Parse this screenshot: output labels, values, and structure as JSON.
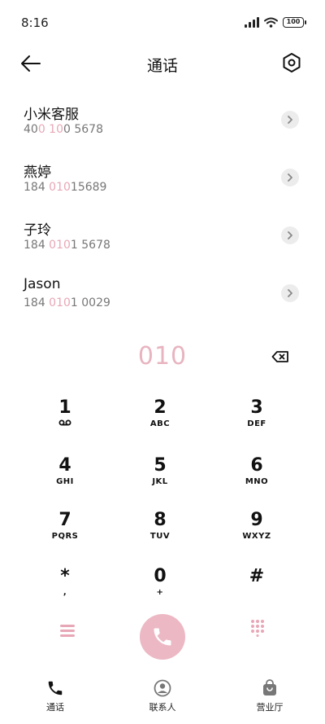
{
  "status_bar": {
    "time": "8:16",
    "battery": "100"
  },
  "header": {
    "title": "通话",
    "back_icon": "arrow-left-icon",
    "settings_icon": "hexagon-settings-icon"
  },
  "contacts": [
    {
      "name": "小米客服",
      "number_pre": "40",
      "number_hl": "0 10",
      "number_post": "0 5678"
    },
    {
      "name": "燕婷",
      "number_pre": "184 ",
      "number_hl": "010",
      "number_post": "15689"
    },
    {
      "name": "子玲",
      "number_pre": "184 ",
      "number_hl": "010",
      "number_post": "1 5678"
    },
    {
      "name": "Jason",
      "number_pre": "184 ",
      "number_hl": "010",
      "number_post": "1 0029"
    }
  ],
  "dialer": {
    "input": "010"
  },
  "keypad": [
    {
      "digit": "1",
      "letters": "",
      "sub": "voicemail-icon"
    },
    {
      "digit": "2",
      "letters": "ABC"
    },
    {
      "digit": "3",
      "letters": "DEF"
    },
    {
      "digit": "4",
      "letters": "GHI"
    },
    {
      "digit": "5",
      "letters": "JKL"
    },
    {
      "digit": "6",
      "letters": "MNO"
    },
    {
      "digit": "7",
      "letters": "PQRS"
    },
    {
      "digit": "8",
      "letters": "TUV"
    },
    {
      "digit": "9",
      "letters": "WXYZ"
    },
    {
      "digit": "*",
      "letters": ","
    },
    {
      "digit": "0",
      "letters": "+"
    },
    {
      "digit": "#",
      "letters": ""
    }
  ],
  "bottom_nav": [
    {
      "label": "通话",
      "icon": "phone-icon",
      "active": true
    },
    {
      "label": "联系人",
      "icon": "contact-icon",
      "active": false
    },
    {
      "label": "营业厅",
      "icon": "shopping-bag-icon",
      "active": false
    }
  ],
  "colors": {
    "accent": "#e8a7b6",
    "call_button": "#ecb8c4",
    "text": "#111111",
    "secondary_text": "#777777"
  }
}
